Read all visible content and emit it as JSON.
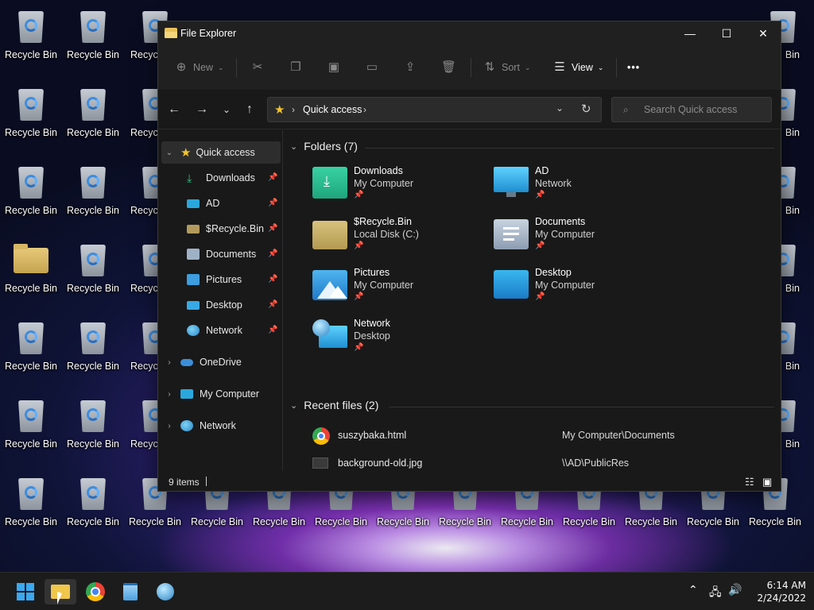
{
  "desktop": {
    "recycle_label": "Recycle Bin",
    "partial_label_left": "Recycl",
    "partial_label_right": "Bin"
  },
  "window": {
    "title": "File Explorer",
    "controls": {
      "minimize": "—",
      "maximize": "☐",
      "close": "✕"
    }
  },
  "toolbar": {
    "new_label": "New",
    "sort_label": "Sort",
    "view_label": "View",
    "more_label": "•••"
  },
  "address": {
    "location": "Quick access",
    "separator": "›",
    "search_placeholder": "Search Quick access"
  },
  "nav": {
    "quick_access": "Quick access",
    "pinned": [
      {
        "label": "Downloads",
        "icon": "download-icon"
      },
      {
        "label": "AD",
        "icon": "monitor-icon"
      },
      {
        "label": "$Recycle.Bin",
        "icon": "folder-icon"
      },
      {
        "label": "Documents",
        "icon": "documents-icon"
      },
      {
        "label": "Pictures",
        "icon": "pictures-icon"
      },
      {
        "label": "Desktop",
        "icon": "desktop-icon"
      },
      {
        "label": "Network",
        "icon": "network-icon"
      }
    ],
    "roots": [
      {
        "label": "OneDrive",
        "icon": "cloud-icon"
      },
      {
        "label": "My Computer",
        "icon": "monitor-icon"
      },
      {
        "label": "Network",
        "icon": "network-icon"
      }
    ]
  },
  "folders": {
    "header": "Folders (7)",
    "items": [
      {
        "name": "Downloads",
        "location": "My Computer",
        "icon": "downloads-folder-icon"
      },
      {
        "name": "AD",
        "location": "Network",
        "icon": "monitor-icon"
      },
      {
        "name": "$Recycle.Bin",
        "location": "Local Disk (C:)",
        "icon": "folder-icon"
      },
      {
        "name": "Documents",
        "location": "My Computer",
        "icon": "documents-folder-icon"
      },
      {
        "name": "Pictures",
        "location": "My Computer",
        "icon": "pictures-folder-icon"
      },
      {
        "name": "Desktop",
        "location": "My Computer",
        "icon": "desktop-folder-icon"
      },
      {
        "name": "Network",
        "location": "Desktop",
        "icon": "network-icon"
      }
    ]
  },
  "recent": {
    "header": "Recent files (2)",
    "items": [
      {
        "name": "suszybaka.html",
        "path": "My Computer\\Documents",
        "icon": "chrome-icon"
      },
      {
        "name": "background-old.jpg",
        "path": "\\\\AD\\PublicRes",
        "icon": "image-file-icon"
      }
    ]
  },
  "status": {
    "count": "9 items"
  },
  "taskbar": {
    "time": "6:14 AM",
    "date": "2/24/2022"
  },
  "colors": {
    "accent_star": "#f3c42b",
    "folder_yellow": "#d8b862",
    "window_bg": "#191919",
    "toolbar_bg": "#202020"
  }
}
